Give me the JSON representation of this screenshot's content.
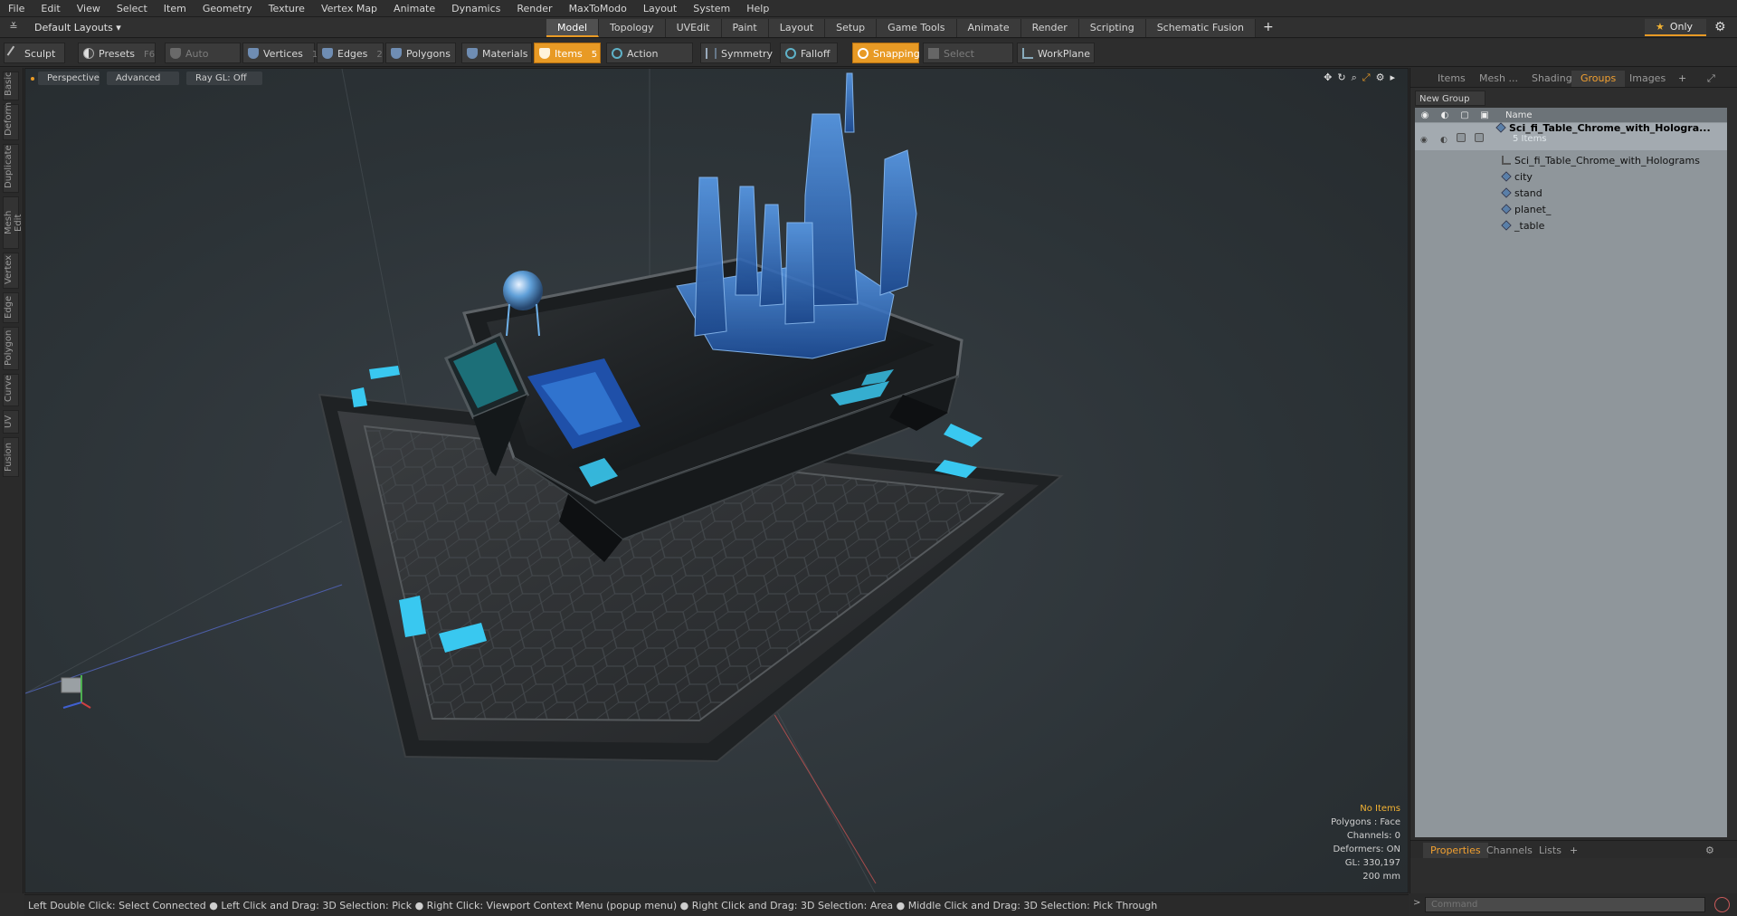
{
  "menu": [
    "File",
    "Edit",
    "View",
    "Select",
    "Item",
    "Geometry",
    "Texture",
    "Vertex Map",
    "Animate",
    "Dynamics",
    "Render",
    "MaxToModo",
    "Layout",
    "System",
    "Help"
  ],
  "layout_selector": "Default Layouts ▾",
  "tabs": [
    "Model",
    "Topology",
    "UVEdit",
    "Paint",
    "Layout",
    "Setup",
    "Game Tools",
    "Animate",
    "Render",
    "Scripting",
    "Schematic Fusion"
  ],
  "active_tab": "Model",
  "only_label": "Only",
  "toolbar": {
    "sculpt": "Sculpt",
    "presets": "Presets",
    "presets_key": "F6",
    "auto_select": "Auto Select",
    "vertices": "Vertices",
    "vertices_key": "1",
    "edges": "Edges",
    "edges_key": "2",
    "polygons": "Polygons",
    "materials": "Materials",
    "items": "Items",
    "items_key": "5",
    "action_center": "Action Center",
    "symmetry": "Symmetry",
    "falloff": "Falloff",
    "snapping": "Snapping",
    "select_through": "Select Through",
    "workplane": "WorkPlane"
  },
  "left_tabs": [
    "Basic",
    "Deform",
    "Duplicate",
    "Mesh Edit",
    "Vertex",
    "Edge",
    "Polygon",
    "Curve",
    "UV",
    "Fusion"
  ],
  "viewport": {
    "view": "Perspective",
    "shading": "Advanced",
    "raygl": "Ray GL: Off",
    "info": {
      "selection": "No Items",
      "polygons": "Polygons : Face",
      "channels": "Channels: 0",
      "deformers": "Deformers: ON",
      "gl": "GL: 330,197",
      "units": "200 mm"
    }
  },
  "right_panel": {
    "tabs": [
      "Items",
      "Mesh ...",
      "Shading",
      "Groups",
      "Images"
    ],
    "active_tab": "Groups",
    "new_group": "New Group",
    "column_name": "Name",
    "tree": {
      "group_name": "Sci_fi_Table_Chrome_with_Hologra...",
      "group_count": "5 Items",
      "children": [
        "Sci_fi_Table_Chrome_with_Holograms",
        "city",
        "stand",
        "planet_",
        "_table"
      ]
    },
    "bottom_tabs": [
      "Properties",
      "Channels",
      "Lists"
    ],
    "bottom_active": "Properties"
  },
  "command_placeholder": "Command",
  "status_bar": "Left Double Click: Select Connected ● Left Click and Drag: 3D Selection: Pick ● Right Click: Viewport Context Menu (popup menu) ● Right Click and Drag: 3D Selection: Area ● Middle Click and Drag: 3D Selection: Pick Through",
  "colors": {
    "accent": "#e89a25",
    "hologram": "#3a8fe0",
    "cyan_light": "#39c8f0"
  }
}
